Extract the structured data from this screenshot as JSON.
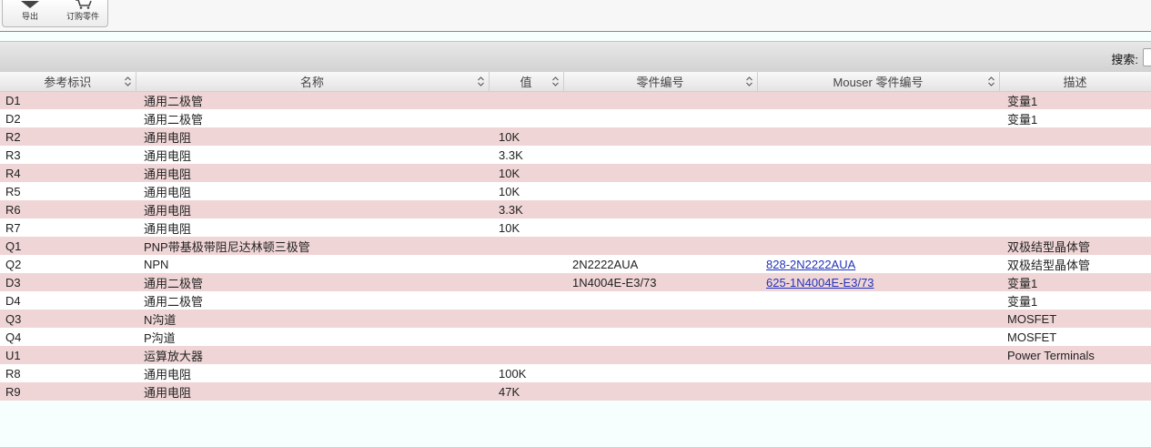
{
  "toolbar": {
    "export_label": "导出",
    "order_label": "订购零件",
    "export_icon": "download-icon",
    "order_icon": "cart-icon"
  },
  "search": {
    "label": "搜索:"
  },
  "table": {
    "columns": [
      "参考标识",
      "名称",
      "值",
      "零件编号",
      "Mouser 零件编号",
      "描述"
    ],
    "rows": [
      {
        "ref": "D1",
        "name": "通用二极管",
        "value": "",
        "part": "",
        "mouser": "",
        "desc": "变量1"
      },
      {
        "ref": "D2",
        "name": "通用二极管",
        "value": "",
        "part": "",
        "mouser": "",
        "desc": "变量1"
      },
      {
        "ref": "R2",
        "name": "通用电阻",
        "value": "10K",
        "part": "",
        "mouser": "",
        "desc": ""
      },
      {
        "ref": "R3",
        "name": "通用电阻",
        "value": "3.3K",
        "part": "",
        "mouser": "",
        "desc": ""
      },
      {
        "ref": "R4",
        "name": "通用电阻",
        "value": "10K",
        "part": "",
        "mouser": "",
        "desc": ""
      },
      {
        "ref": "R5",
        "name": "通用电阻",
        "value": "10K",
        "part": "",
        "mouser": "",
        "desc": ""
      },
      {
        "ref": "R6",
        "name": "通用电阻",
        "value": "3.3K",
        "part": "",
        "mouser": "",
        "desc": ""
      },
      {
        "ref": "R7",
        "name": "通用电阻",
        "value": "10K",
        "part": "",
        "mouser": "",
        "desc": ""
      },
      {
        "ref": "Q1",
        "name": "PNP带基极带阻尼达林顿三极管",
        "value": "",
        "part": "",
        "mouser": "",
        "desc": "双极结型晶体管"
      },
      {
        "ref": "Q2",
        "name": "NPN",
        "value": "",
        "part": "2N2222AUA",
        "mouser": "828-2N2222AUA",
        "desc": "双极结型晶体管"
      },
      {
        "ref": "D3",
        "name": "通用二极管",
        "value": "",
        "part": "1N4004E-E3/73",
        "mouser": "625-1N4004E-E3/73",
        "desc": "变量1"
      },
      {
        "ref": "D4",
        "name": "通用二极管",
        "value": "",
        "part": "",
        "mouser": "",
        "desc": "变量1"
      },
      {
        "ref": "Q3",
        "name": "N沟道",
        "value": "",
        "part": "",
        "mouser": "",
        "desc": "MOSFET"
      },
      {
        "ref": "Q4",
        "name": "P沟道",
        "value": "",
        "part": "",
        "mouser": "",
        "desc": "MOSFET"
      },
      {
        "ref": "U1",
        "name": "运算放大器",
        "value": "",
        "part": "",
        "mouser": "",
        "desc": "Power Terminals"
      },
      {
        "ref": "R8",
        "name": "通用电阻",
        "value": "100K",
        "part": "",
        "mouser": "",
        "desc": ""
      },
      {
        "ref": "R9",
        "name": "通用电阻",
        "value": "47K",
        "part": "",
        "mouser": "",
        "desc": ""
      }
    ]
  },
  "colors": {
    "row_odd": "#f0d5d6",
    "row_even": "#ffffff",
    "link": "#2233bb",
    "page_bg": "#f6fefe"
  }
}
